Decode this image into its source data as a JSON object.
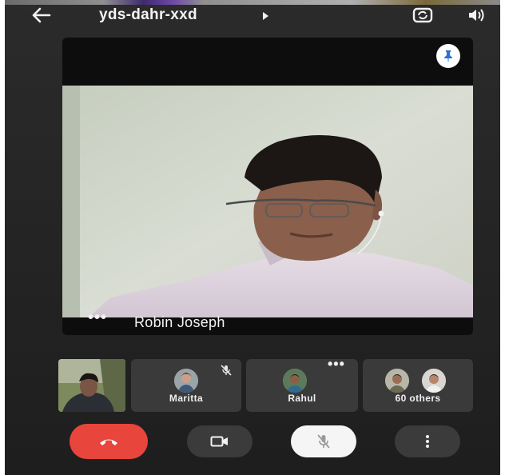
{
  "meeting": {
    "title": "yds-dahr-xxd"
  },
  "main_speaker": {
    "name": "Robin Joseph",
    "more_glyph": "•••"
  },
  "participants": [
    {
      "name": "Maritta",
      "muted": true
    },
    {
      "name": "Rahul",
      "more_glyph": "•••"
    },
    {
      "name": "60 others"
    }
  ],
  "icons": {
    "back": "arrow-left-icon",
    "title_chevron": "play-arrow-icon",
    "switch_camera": "switch-camera-icon",
    "speaker": "volume-icon",
    "pin": "pin-icon",
    "end_call": "phone-hangup-icon",
    "camera": "video-camera-icon",
    "mic": "mic-off-icon",
    "more": "more-vert-icon"
  },
  "colors": {
    "end_call": "#e8453c",
    "pin_icon": "#2f6fd6",
    "control_dark": "#3b3b3b",
    "control_light": "#f5f5f5"
  }
}
